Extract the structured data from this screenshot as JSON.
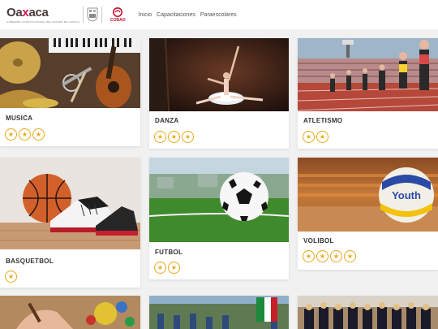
{
  "header": {
    "brand_word_a": "Oa",
    "brand_word_x": "x",
    "brand_word_b": "aca",
    "brand_sub": "GOBIERNO CONSTITUCIONAL DEL ESTADO DE OAXACA",
    "cobao_label": "COBAO",
    "nav": [
      "Inicio",
      "Capacitaciones",
      "Paraescolares"
    ]
  },
  "colors": {
    "accent_star": "#e6a817",
    "brand_red": "#c8102e",
    "brand_pink": "#d4145a"
  },
  "cards": [
    {
      "title": "MUSICA",
      "stars": 3,
      "icon": "music-instruments-image"
    },
    {
      "title": "DANZA",
      "stars": 3,
      "icon": "ballet-dancer-image"
    },
    {
      "title": "ATLETISMO",
      "stars": 2,
      "icon": "sprinters-track-image"
    },
    {
      "title": "BASQUETBOL",
      "stars": 1,
      "icon": "basketball-sneakers-image"
    },
    {
      "title": "FUTBOL",
      "stars": 2,
      "icon": "soccer-ball-field-image"
    },
    {
      "title": "VOLIBOL",
      "stars": 4,
      "icon": "volleyball-court-image"
    },
    {
      "title": "",
      "stars": 0,
      "icon": "painting-hands-image"
    },
    {
      "title": "",
      "stars": 0,
      "icon": "parade-flag-image"
    },
    {
      "title": "",
      "stars": 0,
      "icon": "band-uniforms-image"
    }
  ],
  "volleyball_text": "Youth"
}
